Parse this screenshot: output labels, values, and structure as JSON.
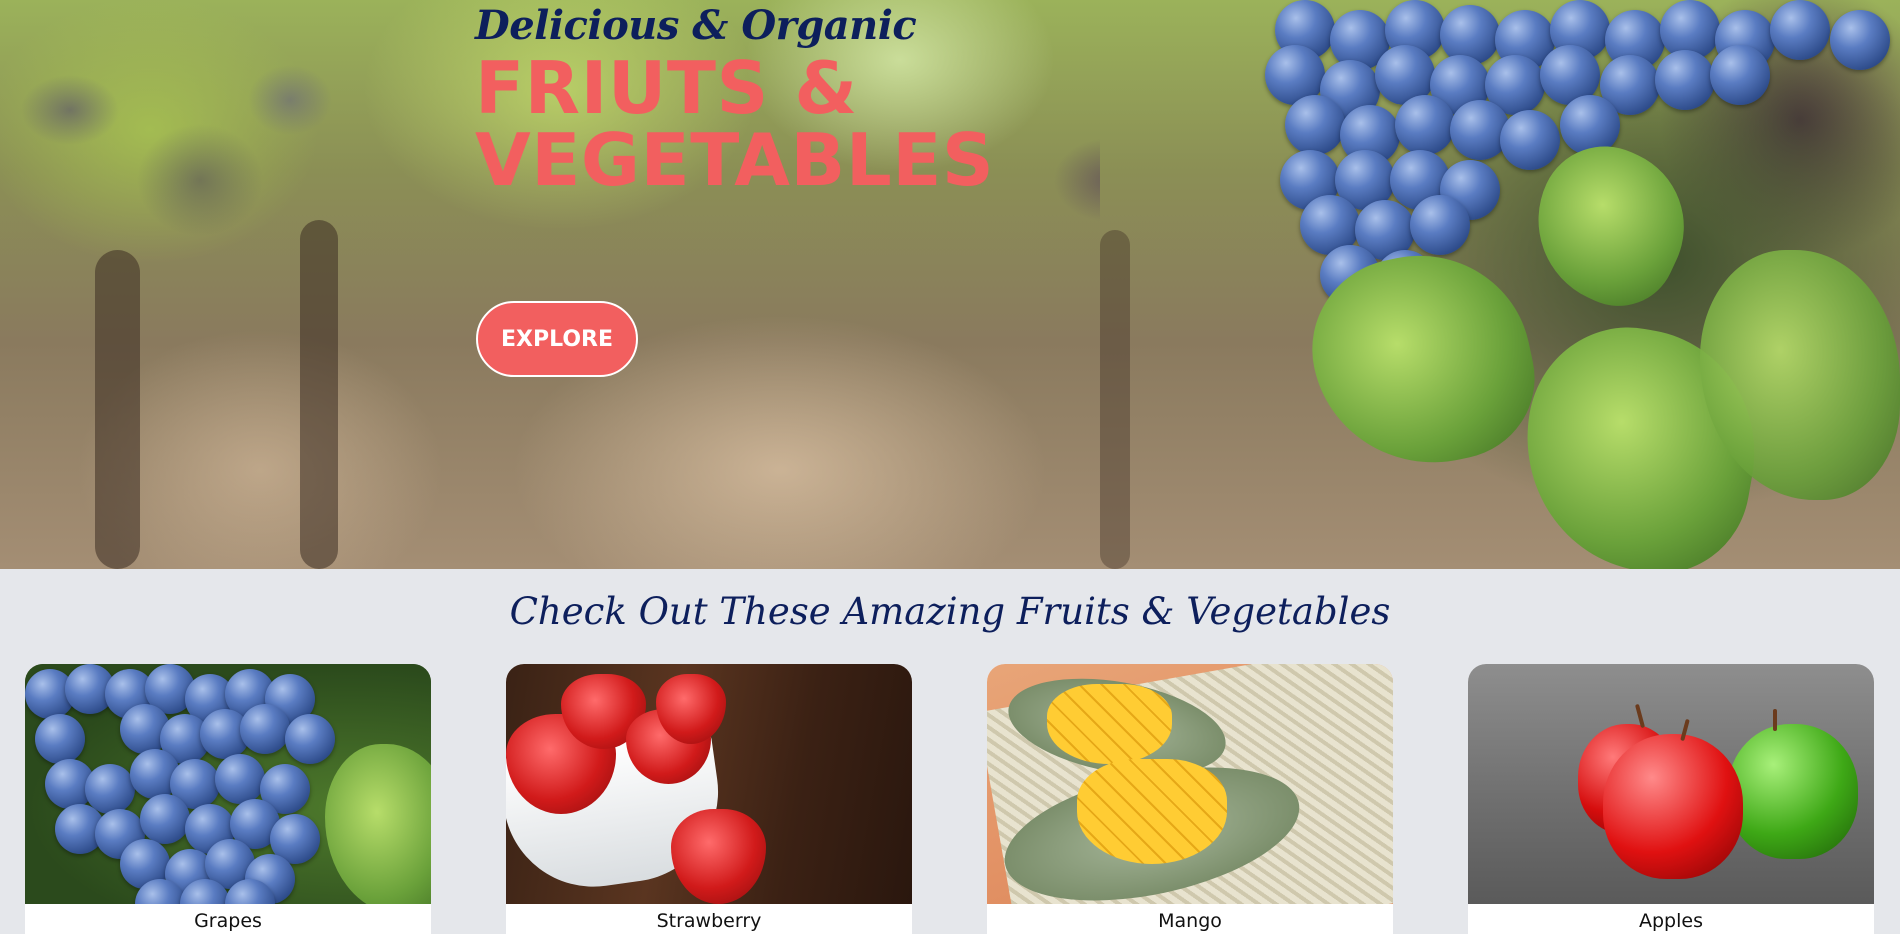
{
  "hero": {
    "tagline": "Delicious & Organic",
    "headline_line1": "FRIUTS &",
    "headline_line2": "VEGETABLES",
    "explore_label": "EXPLORE"
  },
  "section": {
    "title": "Check Out These Amazing Fruits & Vegetables"
  },
  "cards": [
    {
      "label": "Grapes",
      "image": "grapes"
    },
    {
      "label": "Strawberry",
      "image": "strawberries"
    },
    {
      "label": "Mango",
      "image": "mango"
    },
    {
      "label": "Apples",
      "image": "apples"
    }
  ],
  "colors": {
    "accent": "#f25f5f",
    "navy": "#0d1f5c",
    "section_bg": "#e5e7eb"
  }
}
